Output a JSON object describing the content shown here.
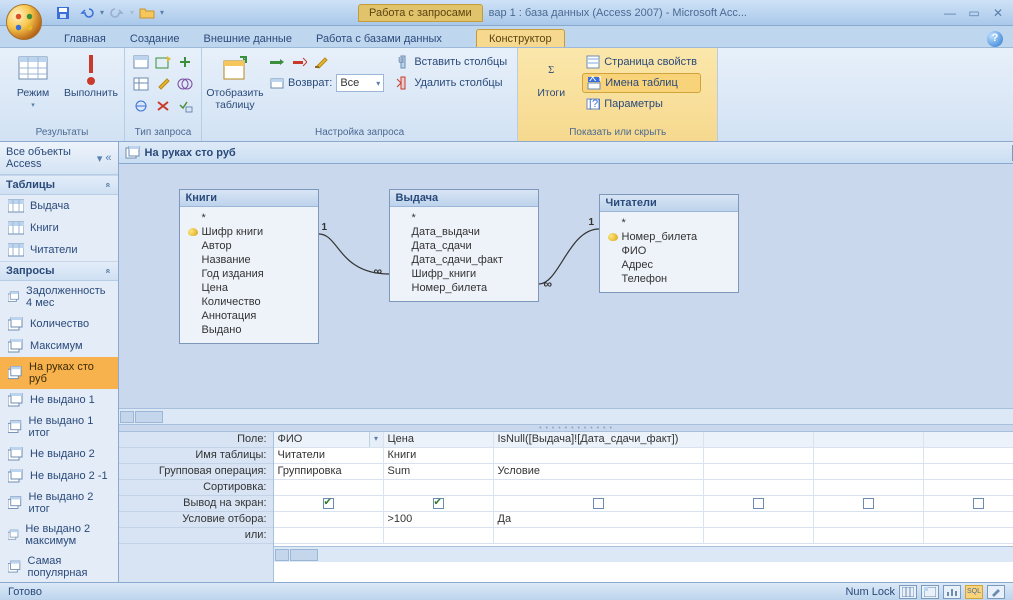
{
  "title_bar": {
    "context_tab": "Работа с запросами",
    "app_title": "вар 1 : база данных (Access 2007) - Microsoft Acc..."
  },
  "tabs": {
    "home": "Главная",
    "create": "Создание",
    "external": "Внешние данные",
    "dbtools": "Работа с базами данных",
    "designer": "Конструктор"
  },
  "ribbon": {
    "results": {
      "view": "Режим",
      "run": "Выполнить",
      "label": "Результаты"
    },
    "qtype_label": "Тип запроса",
    "setup": {
      "show_table": "Отобразить\nтаблицу",
      "insert_cols": "Вставить столбцы",
      "delete_cols": "Удалить столбцы",
      "return": "Возврат:",
      "return_value": "Все",
      "label": "Настройка запроса"
    },
    "showhide": {
      "totals": "Итоги",
      "propsheet": "Страница свойств",
      "tablenames": "Имена таблиц",
      "params": "Параметры",
      "label": "Показать или скрыть"
    }
  },
  "nav": {
    "title": "Все объекты Access",
    "tables_h": "Таблицы",
    "tables": [
      "Выдача",
      "Книги",
      "Читатели"
    ],
    "queries_h": "Запросы",
    "queries": [
      "Задолженность 4 мес",
      "Количество",
      "Максимум",
      "На руках сто руб",
      "Не выдано 1",
      "Не выдано 1 итог",
      "Не выдано 2",
      "Не выдано 2 -1",
      "Не выдано 2 итог",
      "Не выдано 2 максимум",
      "Самая популярная"
    ],
    "selected_query": "На руках сто руб"
  },
  "doc_tab": "На руках сто руб",
  "tables": {
    "t1": {
      "title": "Книги",
      "fields": [
        "Шифр книги",
        "Автор",
        "Название",
        "Год издания",
        "Цена",
        "Количество",
        "Аннотация",
        "Выдано"
      ],
      "key": 0
    },
    "t2": {
      "title": "Выдача",
      "fields": [
        "Дата_выдачи",
        "Дата_сдачи",
        "Дата_сдачи_факт",
        "Шифр_книги",
        "Номер_билета"
      ]
    },
    "t3": {
      "title": "Читатели",
      "fields": [
        "Номер_билета",
        "ФИО",
        "Адрес",
        "Телефон"
      ],
      "key": 0
    }
  },
  "relation_labels": {
    "one": "1",
    "many": "∞"
  },
  "qbe": {
    "labels": [
      "Поле:",
      "Имя таблицы:",
      "Групповая операция:",
      "Сортировка:",
      "Вывод на экран:",
      "Условие отбора:",
      "или:"
    ],
    "cols": [
      {
        "field": "ФИО",
        "table": "Читатели",
        "op": "Группировка",
        "show": true,
        "crit": "",
        "dd": true
      },
      {
        "field": "Цена",
        "table": "Книги",
        "op": "Sum",
        "show": true,
        "crit": ">100"
      },
      {
        "field": "IsNull([Выдача]![Дата_сдачи_факт])",
        "table": "",
        "op": "Условие",
        "show": false,
        "crit": "Да",
        "wide": true
      },
      {
        "field": "",
        "table": "",
        "op": "",
        "show": false,
        "crit": ""
      },
      {
        "field": "",
        "table": "",
        "op": "",
        "show": false,
        "crit": ""
      },
      {
        "field": "",
        "table": "",
        "op": "",
        "show": false,
        "crit": ""
      }
    ]
  },
  "status": {
    "ready": "Готово",
    "numlock": "Num Lock",
    "sql": "SQL"
  }
}
